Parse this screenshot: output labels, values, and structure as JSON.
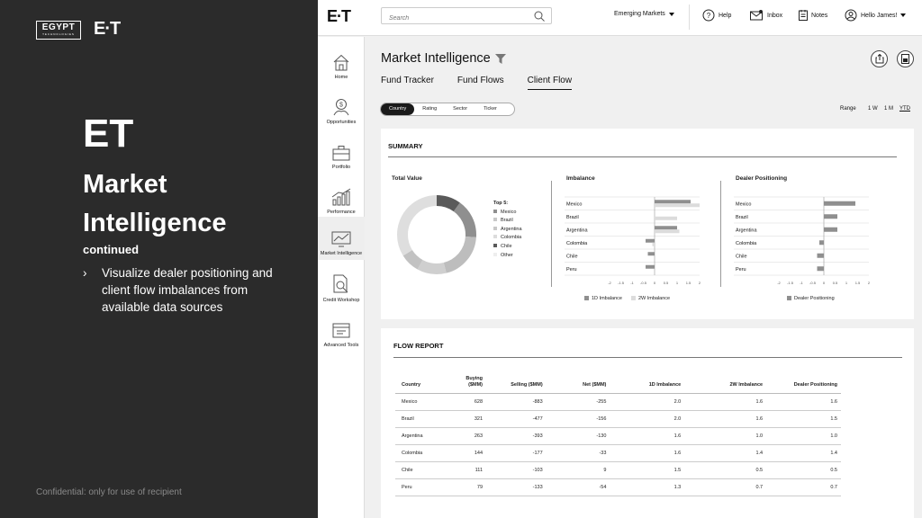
{
  "left_panel": {
    "logo_egypt_line1": "EGYPT",
    "logo_egypt_line2": "TECHNOLOGIES",
    "logo_et": "E·T",
    "heading": "ET",
    "title": "Market Intelligence",
    "subtitle": "continued",
    "bullet_marker": "›",
    "bullet": "Visualize dealer positioning and client flow imbalances from available data sources",
    "footer": "Confidential: only for use of recipient"
  },
  "topbar": {
    "logo": "E·T",
    "search_placeholder": "Search",
    "market_select": "Emerging Markets",
    "help": "Help",
    "inbox": "Inbox",
    "notes": "Notes",
    "user": "Hello James!"
  },
  "sidebar": {
    "items": [
      {
        "label": "Home",
        "icon": "home-icon"
      },
      {
        "label": "Opportunities",
        "icon": "opportunities-icon"
      },
      {
        "label": "Portfolio",
        "icon": "portfolio-icon"
      },
      {
        "label": "Performance",
        "icon": "performance-icon"
      },
      {
        "label": "Market Intelligence",
        "icon": "market-intelligence-icon"
      },
      {
        "label": "Credit Workshop",
        "icon": "credit-workshop-icon"
      },
      {
        "label": "Advanced Tools",
        "icon": "advanced-tools-icon"
      }
    ]
  },
  "header": {
    "title": "Market Intelligence",
    "tabs": [
      "Fund Tracker",
      "Fund Flows",
      "Client Flow"
    ],
    "active_tab": "Client Flow"
  },
  "filters": {
    "segments": [
      "Country",
      "Rating",
      "Sector",
      "Ticker"
    ],
    "active_segment": "Country",
    "range_label": "Range",
    "range_options": [
      "1 W",
      "1 M",
      "YTD"
    ],
    "active_range": "YTD"
  },
  "summary": {
    "title": "SUMMARY",
    "total_value_title": "Total Value",
    "imbalance_title": "Imbalance",
    "dealer_title": "Dealer Positioning",
    "top5_title": "Top 5:",
    "legend_1d": "1D Imbalance",
    "legend_2w": "2W Imbalance",
    "legend_dealer": "Dealer Positioning",
    "colors": {
      "dark": "#5a5a5a",
      "mid": "#8f8f8f",
      "light": "#c8c8c8",
      "lighter": "#dcdcdc"
    }
  },
  "chart_data": [
    {
      "type": "pie",
      "title": "Total Value",
      "categories": [
        "Mexico",
        "Brazil",
        "Argentina",
        "Colombia",
        "Chile",
        "Other"
      ],
      "values": [
        10,
        16,
        20,
        12,
        8,
        34
      ]
    },
    {
      "type": "bar",
      "orientation": "horizontal",
      "title": "Imbalance",
      "categories": [
        "Mexico",
        "Brazil",
        "Argentina",
        "Colombia",
        "Chile",
        "Peru"
      ],
      "series": [
        {
          "name": "1D Imbalance",
          "values": [
            1.6,
            0.0,
            1.0,
            -0.4,
            -0.3,
            -0.4
          ]
        },
        {
          "name": "2W Imbalance",
          "values": [
            2.0,
            1.0,
            1.1,
            -0.1,
            0.0,
            0.0
          ]
        }
      ],
      "xlim": [
        -2,
        2
      ],
      "xticks": [
        "-2",
        "-1.5",
        "-1",
        "-0.5",
        "0",
        "0.5",
        "1",
        "1.5",
        "2"
      ]
    },
    {
      "type": "bar",
      "orientation": "horizontal",
      "title": "Dealer Positioning",
      "categories": [
        "Mexico",
        "Brazil",
        "Argentina",
        "Colombia",
        "Chile",
        "Peru"
      ],
      "series": [
        {
          "name": "Dealer Positioning",
          "values": [
            1.4,
            0.6,
            0.6,
            -0.2,
            -0.3,
            -0.3
          ]
        }
      ],
      "xlim": [
        -2,
        2
      ],
      "xticks": [
        "-2",
        "-1.5",
        "-1",
        "-0.5",
        "0",
        "0.5",
        "1",
        "1.5",
        "2"
      ]
    }
  ],
  "flow_report": {
    "title": "FLOW REPORT",
    "columns": [
      "Country",
      "Buying ($MM)",
      "Selling ($MM)",
      "Net ($MM)",
      "1D Imbalance",
      "2W Imbalance",
      "Dealer Positioning"
    ],
    "rows": [
      [
        "Mexico",
        "628",
        "-883",
        "-255",
        "2.0",
        "1.6",
        "1.6"
      ],
      [
        "Brazil",
        "321",
        "-477",
        "-156",
        "2.0",
        "1.6",
        "1.5"
      ],
      [
        "Argentina",
        "263",
        "-393",
        "-130",
        "1.6",
        "1.0",
        "1.0"
      ],
      [
        "Colombia",
        "144",
        "-177",
        "-33",
        "1.6",
        "1.4",
        "1.4"
      ],
      [
        "Chile",
        "111",
        "-103",
        "9",
        "1.5",
        "0.5",
        "0.5"
      ],
      [
        "Peru",
        "79",
        "-133",
        "-54",
        "1.3",
        "0.7",
        "0.7"
      ]
    ]
  }
}
